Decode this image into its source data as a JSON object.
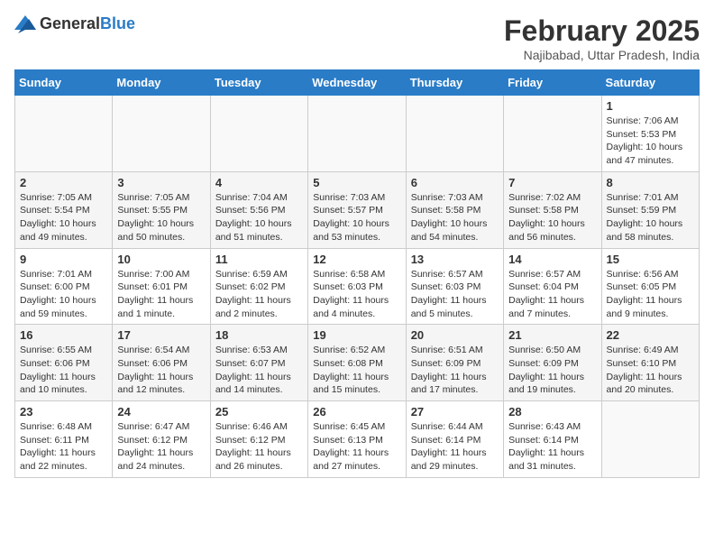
{
  "header": {
    "logo_general": "General",
    "logo_blue": "Blue",
    "month": "February 2025",
    "location": "Najibabad, Uttar Pradesh, India"
  },
  "weekdays": [
    "Sunday",
    "Monday",
    "Tuesday",
    "Wednesday",
    "Thursday",
    "Friday",
    "Saturday"
  ],
  "weeks": [
    [
      {
        "day": "",
        "info": ""
      },
      {
        "day": "",
        "info": ""
      },
      {
        "day": "",
        "info": ""
      },
      {
        "day": "",
        "info": ""
      },
      {
        "day": "",
        "info": ""
      },
      {
        "day": "",
        "info": ""
      },
      {
        "day": "1",
        "info": "Sunrise: 7:06 AM\nSunset: 5:53 PM\nDaylight: 10 hours\nand 47 minutes."
      }
    ],
    [
      {
        "day": "2",
        "info": "Sunrise: 7:05 AM\nSunset: 5:54 PM\nDaylight: 10 hours\nand 49 minutes."
      },
      {
        "day": "3",
        "info": "Sunrise: 7:05 AM\nSunset: 5:55 PM\nDaylight: 10 hours\nand 50 minutes."
      },
      {
        "day": "4",
        "info": "Sunrise: 7:04 AM\nSunset: 5:56 PM\nDaylight: 10 hours\nand 51 minutes."
      },
      {
        "day": "5",
        "info": "Sunrise: 7:03 AM\nSunset: 5:57 PM\nDaylight: 10 hours\nand 53 minutes."
      },
      {
        "day": "6",
        "info": "Sunrise: 7:03 AM\nSunset: 5:58 PM\nDaylight: 10 hours\nand 54 minutes."
      },
      {
        "day": "7",
        "info": "Sunrise: 7:02 AM\nSunset: 5:58 PM\nDaylight: 10 hours\nand 56 minutes."
      },
      {
        "day": "8",
        "info": "Sunrise: 7:01 AM\nSunset: 5:59 PM\nDaylight: 10 hours\nand 58 minutes."
      }
    ],
    [
      {
        "day": "9",
        "info": "Sunrise: 7:01 AM\nSunset: 6:00 PM\nDaylight: 10 hours\nand 59 minutes."
      },
      {
        "day": "10",
        "info": "Sunrise: 7:00 AM\nSunset: 6:01 PM\nDaylight: 11 hours\nand 1 minute."
      },
      {
        "day": "11",
        "info": "Sunrise: 6:59 AM\nSunset: 6:02 PM\nDaylight: 11 hours\nand 2 minutes."
      },
      {
        "day": "12",
        "info": "Sunrise: 6:58 AM\nSunset: 6:03 PM\nDaylight: 11 hours\nand 4 minutes."
      },
      {
        "day": "13",
        "info": "Sunrise: 6:57 AM\nSunset: 6:03 PM\nDaylight: 11 hours\nand 5 minutes."
      },
      {
        "day": "14",
        "info": "Sunrise: 6:57 AM\nSunset: 6:04 PM\nDaylight: 11 hours\nand 7 minutes."
      },
      {
        "day": "15",
        "info": "Sunrise: 6:56 AM\nSunset: 6:05 PM\nDaylight: 11 hours\nand 9 minutes."
      }
    ],
    [
      {
        "day": "16",
        "info": "Sunrise: 6:55 AM\nSunset: 6:06 PM\nDaylight: 11 hours\nand 10 minutes."
      },
      {
        "day": "17",
        "info": "Sunrise: 6:54 AM\nSunset: 6:06 PM\nDaylight: 11 hours\nand 12 minutes."
      },
      {
        "day": "18",
        "info": "Sunrise: 6:53 AM\nSunset: 6:07 PM\nDaylight: 11 hours\nand 14 minutes."
      },
      {
        "day": "19",
        "info": "Sunrise: 6:52 AM\nSunset: 6:08 PM\nDaylight: 11 hours\nand 15 minutes."
      },
      {
        "day": "20",
        "info": "Sunrise: 6:51 AM\nSunset: 6:09 PM\nDaylight: 11 hours\nand 17 minutes."
      },
      {
        "day": "21",
        "info": "Sunrise: 6:50 AM\nSunset: 6:09 PM\nDaylight: 11 hours\nand 19 minutes."
      },
      {
        "day": "22",
        "info": "Sunrise: 6:49 AM\nSunset: 6:10 PM\nDaylight: 11 hours\nand 20 minutes."
      }
    ],
    [
      {
        "day": "23",
        "info": "Sunrise: 6:48 AM\nSunset: 6:11 PM\nDaylight: 11 hours\nand 22 minutes."
      },
      {
        "day": "24",
        "info": "Sunrise: 6:47 AM\nSunset: 6:12 PM\nDaylight: 11 hours\nand 24 minutes."
      },
      {
        "day": "25",
        "info": "Sunrise: 6:46 AM\nSunset: 6:12 PM\nDaylight: 11 hours\nand 26 minutes."
      },
      {
        "day": "26",
        "info": "Sunrise: 6:45 AM\nSunset: 6:13 PM\nDaylight: 11 hours\nand 27 minutes."
      },
      {
        "day": "27",
        "info": "Sunrise: 6:44 AM\nSunset: 6:14 PM\nDaylight: 11 hours\nand 29 minutes."
      },
      {
        "day": "28",
        "info": "Sunrise: 6:43 AM\nSunset: 6:14 PM\nDaylight: 11 hours\nand 31 minutes."
      },
      {
        "day": "",
        "info": ""
      }
    ]
  ]
}
